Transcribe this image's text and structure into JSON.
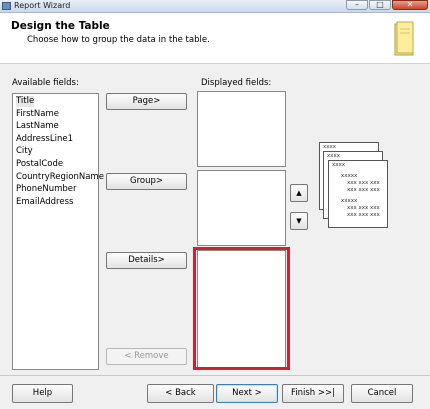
{
  "window": {
    "title": "Report Wizard",
    "minimize": "–",
    "maximize": "□",
    "close": "✕"
  },
  "header": {
    "title": "Design the Table",
    "subtitle": "Choose how to group the data in the table."
  },
  "available": {
    "label": "Available fields:",
    "items": [
      "Title",
      "FirstName",
      "LastName",
      "AddressLine1",
      "City",
      "PostalCode",
      "CountryRegionName",
      "PhoneNumber",
      "EmailAddress"
    ],
    "selected_index": 0
  },
  "buttons": {
    "page": "Page>",
    "group": "Group>",
    "details": "Details>",
    "remove": "< Remove"
  },
  "displayed": {
    "label": "Displayed fields:"
  },
  "arrows": {
    "up": "▲",
    "down": "▼"
  },
  "preview": {
    "card1": "xxxx",
    "card2": "xxxx",
    "card3": "xxxx",
    "rows": [
      "xxxxx",
      "xxx xxx xxx",
      "xxx xxx xxx",
      "xxxxx",
      "xxx xxx xxx",
      "xxx xxx xxx"
    ]
  },
  "footer": {
    "help": "Help",
    "back": "< Back",
    "next": "Next >",
    "finish": "Finish >>|",
    "cancel": "Cancel"
  }
}
